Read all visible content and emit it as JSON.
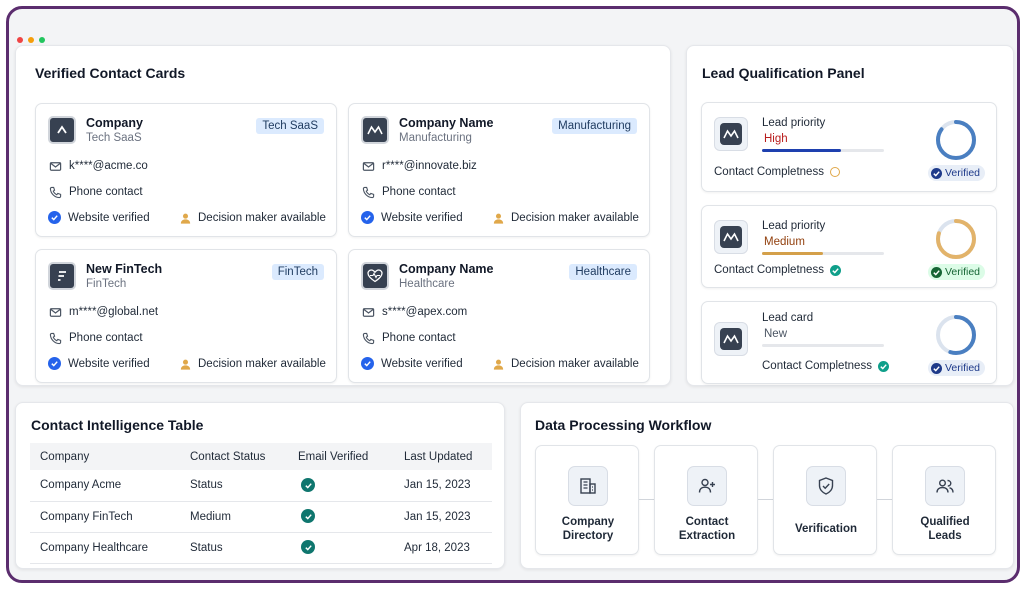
{
  "contact_cards": {
    "title": "Verified Contact Cards",
    "cards": [
      {
        "name": "Company",
        "sub": "Tech SaaS",
        "tag": "Tech SaaS",
        "email": "k****@acme.co",
        "phone": "Phone contact",
        "website": "Website verified",
        "decision": "Decision maker available",
        "logo": "chevron-logo"
      },
      {
        "name": "Company Name",
        "sub": "Manufacturing",
        "tag": "Manufacturing",
        "email": "r****@innovate.biz",
        "phone": "Phone contact",
        "website": "Website verified",
        "decision": "Decision maker available",
        "logo": "mountain-logo"
      },
      {
        "name": "New FinTech",
        "sub": "FinTech",
        "tag": "FinTech",
        "email": "m****@global.net",
        "phone": "Phone contact",
        "website": "Website verified",
        "decision": "Decision maker available",
        "logo": "stripes-logo"
      },
      {
        "name": "Company Name",
        "sub": "Healthcare",
        "tag": "Healthcare",
        "email": "s****@apex.com",
        "phone": "Phone contact",
        "website": "Website verified",
        "decision": "Decision maker available",
        "logo": "heart-pulse-logo"
      }
    ]
  },
  "lead_panel": {
    "title": "Lead Qualification Panel",
    "leads": [
      {
        "label": "Lead priority",
        "value": "High",
        "value_color": "#b91c1c",
        "bar_color": "#1e40af",
        "bar_fill": 0.65,
        "completeness": "Contact Completness",
        "ring_color": "#4a7fc1",
        "ring_fill": 0.85,
        "badge": "Verified",
        "badge_bg": "#e8eef7",
        "badge_fg": "#1e3a8a",
        "badge_icon_color": "#1e3a8a"
      },
      {
        "label": "Lead priority",
        "value": "Medium",
        "value_color": "#92400e",
        "bar_color": "#d4a04a",
        "bar_fill": 0.5,
        "completeness": "Contact Completness",
        "ring_color": "#e2b36a",
        "ring_fill": 0.8,
        "badge": "Verified",
        "badge_bg": "#dcfce7",
        "badge_fg": "#166534",
        "badge_icon_color": "#166534"
      },
      {
        "label": "Lead card",
        "value": "New",
        "value_color": "#4b5563",
        "bar_color": "#e5e7eb",
        "bar_fill": 0,
        "completeness": "Contact Completness",
        "ring_color": "#4a7fc1",
        "ring_fill": 0.55,
        "badge": "Verified",
        "badge_bg": "#e8eef7",
        "badge_fg": "#1e3a8a",
        "badge_icon_color": "#1e3a8a"
      }
    ]
  },
  "table": {
    "title": "Contact Intelligence Table",
    "headers": [
      "Company",
      "Contact Status",
      "Email Verified",
      "Last Updated"
    ],
    "rows": [
      {
        "company": "Company Acme",
        "status": "Status",
        "date": "Jan 15, 2023"
      },
      {
        "company": "Company FinTech",
        "status": "Medium",
        "date": "Jan 15, 2023"
      },
      {
        "company": "Company Healthcare",
        "status": "Status",
        "date": "Apr 18, 2023"
      }
    ]
  },
  "workflow": {
    "title": "Data Processing Workflow",
    "steps": [
      {
        "label1": "Company",
        "label2": "Directory",
        "icon": "building-icon"
      },
      {
        "label1": "Contact",
        "label2": "Extraction",
        "icon": "user-plus-icon"
      },
      {
        "label1": "Verification",
        "label2": "",
        "icon": "shield-check-icon"
      },
      {
        "label1": "Qualified",
        "label2": "Leads",
        "icon": "users-icon"
      }
    ]
  },
  "colors": {
    "frame": "#5b2d6e",
    "accent": "#2563eb",
    "check_teal": "#0f766e"
  }
}
